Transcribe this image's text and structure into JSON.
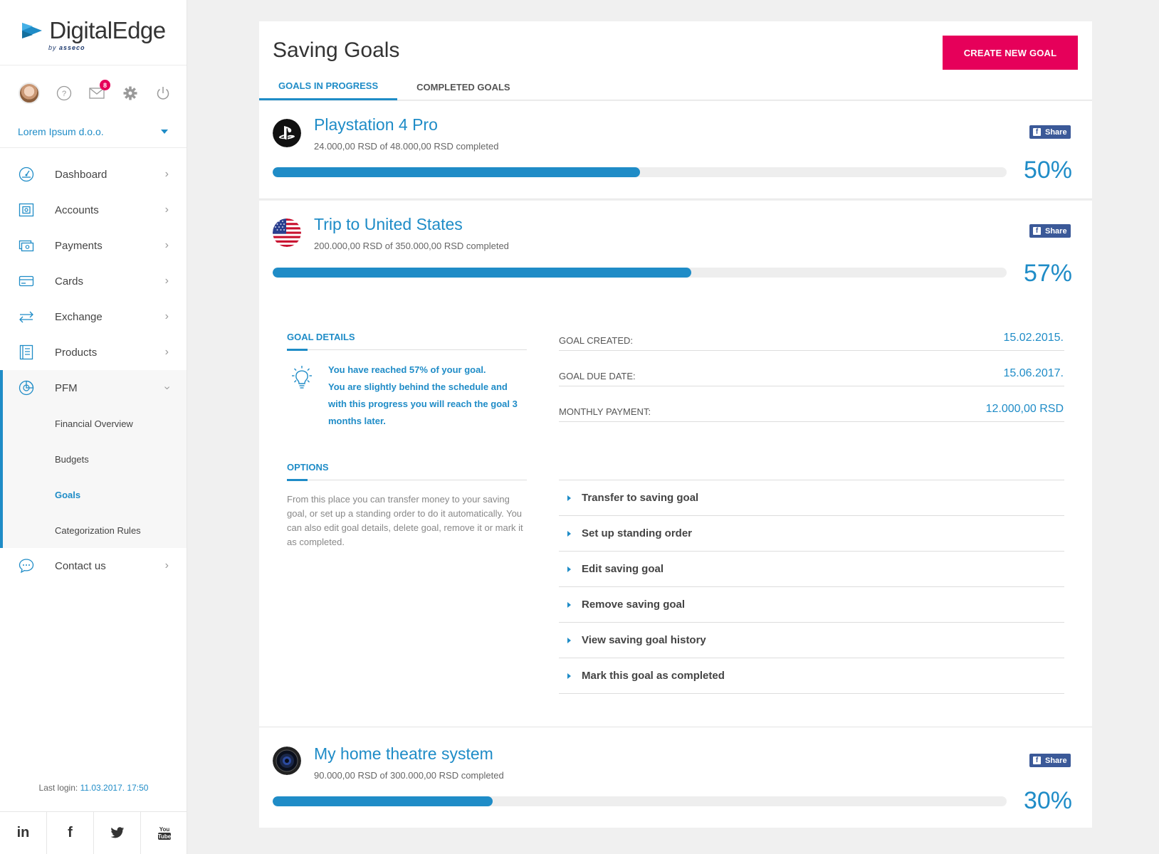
{
  "brand": {
    "name_part1": "Digital",
    "name_part2": "Edge",
    "by": "by",
    "maker": "asseco"
  },
  "user_bar": {
    "icons": [
      "avatar",
      "help-icon",
      "mail-icon",
      "gear-icon",
      "power-icon"
    ],
    "mail_badge": "8"
  },
  "company": "Lorem Ipsum d.o.o.",
  "nav": {
    "items": [
      {
        "label": "Dashboard",
        "icon": "dashboard-icon"
      },
      {
        "label": "Accounts",
        "icon": "accounts-icon"
      },
      {
        "label": "Payments",
        "icon": "payments-icon"
      },
      {
        "label": "Cards",
        "icon": "cards-icon"
      },
      {
        "label": "Exchange",
        "icon": "exchange-icon"
      },
      {
        "label": "Products",
        "icon": "products-icon"
      }
    ],
    "pfm": {
      "label": "PFM",
      "subitems": [
        "Financial Overview",
        "Budgets",
        "Goals",
        "Categorization Rules"
      ],
      "active_sub": "Goals"
    },
    "contact": "Contact us"
  },
  "last_login": {
    "label": "Last login:",
    "value": "11.03.2017. 17:50"
  },
  "social": [
    "in",
    "f",
    "twitter",
    "YouTube"
  ],
  "page": {
    "title": "Saving Goals",
    "create_button": "CREATE NEW GOAL",
    "tabs": [
      "GOALS IN PROGRESS",
      "COMPLETED GOALS"
    ]
  },
  "share_label": "Share",
  "goals": [
    {
      "title": "Playstation 4 Pro",
      "subtitle": "24.000,00 RSD of 48.000,00 RSD completed",
      "percent_label": "50%",
      "progress": 0.5
    },
    {
      "title": "Trip to United States",
      "subtitle": "200.000,00 RSD of 350.000,00 RSD completed",
      "percent_label": "57%",
      "progress": 0.57
    },
    {
      "title": "My home theatre system",
      "subtitle": "90.000,00 RSD of 300.000,00 RSD completed",
      "percent_label": "30%",
      "progress": 0.3
    }
  ],
  "goal_details": {
    "title": "GOAL DETAILS",
    "tip_line1": "You have reached 57% of your goal.",
    "tip_line2": "You are slightly behind the schedule and with this progress you will reach the goal 3 months later.",
    "rows": [
      {
        "label": "GOAL CREATED:",
        "value": "15.02.2015."
      },
      {
        "label": "GOAL DUE DATE:",
        "value": "15.06.2017."
      },
      {
        "label": "MONTHLY PAYMENT:",
        "value": "12.000,00 RSD"
      }
    ]
  },
  "options": {
    "title": "OPTIONS",
    "text": "From this place you can transfer money to your saving goal, or set up a standing order to do it automatically. You can also edit goal details, delete goal, remove it or mark it as completed.",
    "items": [
      "Transfer to saving goal",
      "Set up standing order",
      "Edit saving goal",
      "Remove saving goal",
      "View saving goal history",
      "Mark this goal as completed"
    ]
  },
  "colors": {
    "accent": "#1f8cc7",
    "cta": "#e6005a",
    "facebook": "#3b5998"
  }
}
